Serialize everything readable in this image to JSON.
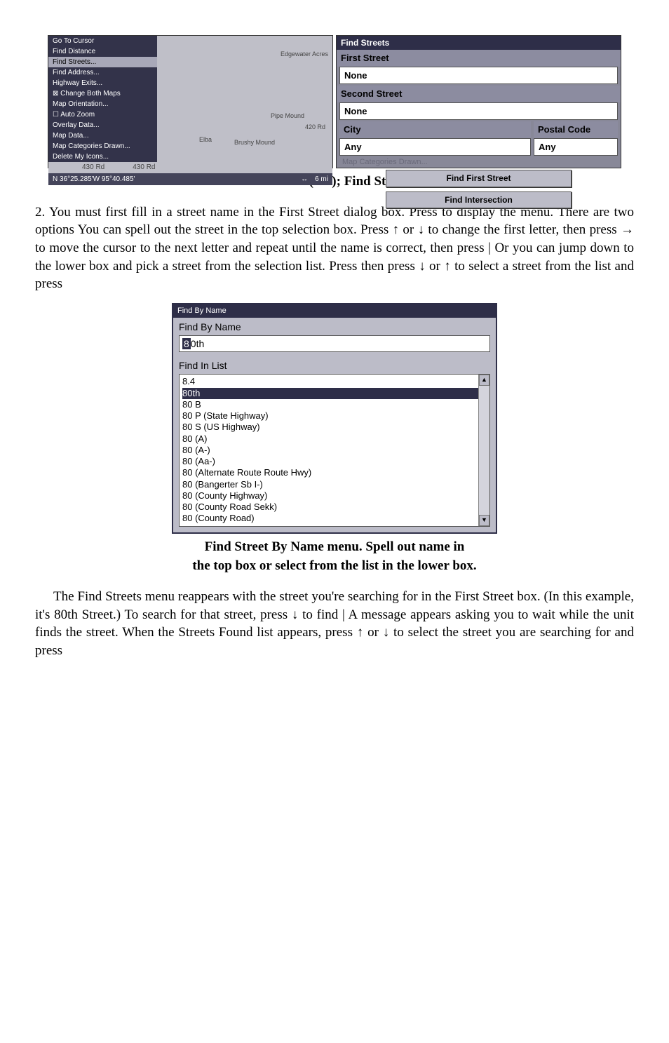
{
  "left_panel": {
    "menu": {
      "items": [
        "Go To Cursor",
        "Find Distance",
        "Find Streets...",
        "Find Address...",
        "Highway Exits...",
        "Change Both Maps",
        "Map Orientation...",
        "Auto Zoom",
        "Overlay Data...",
        "Map Data...",
        "Map Categories Drawn...",
        "Delete My Icons..."
      ]
    },
    "map_labels": {
      "edgewater": "Edgewater Acres",
      "l1": "420 Rd",
      "elba": "Elba",
      "brushy": "Brushy Mound",
      "l430a": "430 Rd",
      "l430b": "430 Rd",
      "pipe": "Pipe Mound"
    },
    "status": {
      "lat": "N   36°25.285'",
      "lon": "W   95°40.485'",
      "arrow": "↔",
      "scale": "6 mi"
    }
  },
  "right_panel": {
    "title": "Find Streets",
    "first_street_label": "First Street",
    "first_street_value": "None",
    "second_street_label": "Second Street",
    "second_street_value": "None",
    "city_label": "City",
    "city_value": "Any",
    "postal_label": "Postal Code",
    "postal_value": "Any",
    "hint": "Map Categories Drawn...",
    "btn_find_first": "Find First Street",
    "btn_find_intersection": "Find Intersection"
  },
  "caption1": "Find Streets command (left); Find Streets menu (right).",
  "para1": "2. You must first fill in a street name in the First Street dialog box. Press to display the menu. There are two options You can spell out the street in the top selection box. Press ↑ or ↓ to change the first letter, then press → to move the cursor to the next letter and repeat until the name is correct, then press | Or you can jump down to the lower box and pick a street from the selection list. Press then press ↓ or ↑ to select a street from the list and press",
  "fbn": {
    "title": "Find By Name",
    "label1": "Find By Name",
    "input_highlight": "8",
    "input_rest": "0th",
    "label2": "Find In List",
    "list": [
      "8.4",
      "80th",
      "80  B",
      "80  P (State Highway)",
      "80  S (US Highway)",
      "80 (A)",
      "80 (A-)",
      "80 (Aa-)",
      "80 (Alternate Route Route Hwy)",
      "80 (Bangerter Sb I-)",
      "80 (County Highway)",
      "80 (County Road Sekk)",
      "80 (County Road)"
    ],
    "selected_index": 1
  },
  "caption2a": "Find Street By Name menu. Spell out name in",
  "caption2b": "the top box or select from the list in the lower box.",
  "para2": "The Find Streets menu reappears with the street you're searching for in the First Street box. (In this example, it's 80th Street.) To search for that street, press ↓ to find | A message appears asking you to wait while the unit finds the street. When the Streets Found list appears, press ↑ or ↓ to select the street you are searching for and press"
}
